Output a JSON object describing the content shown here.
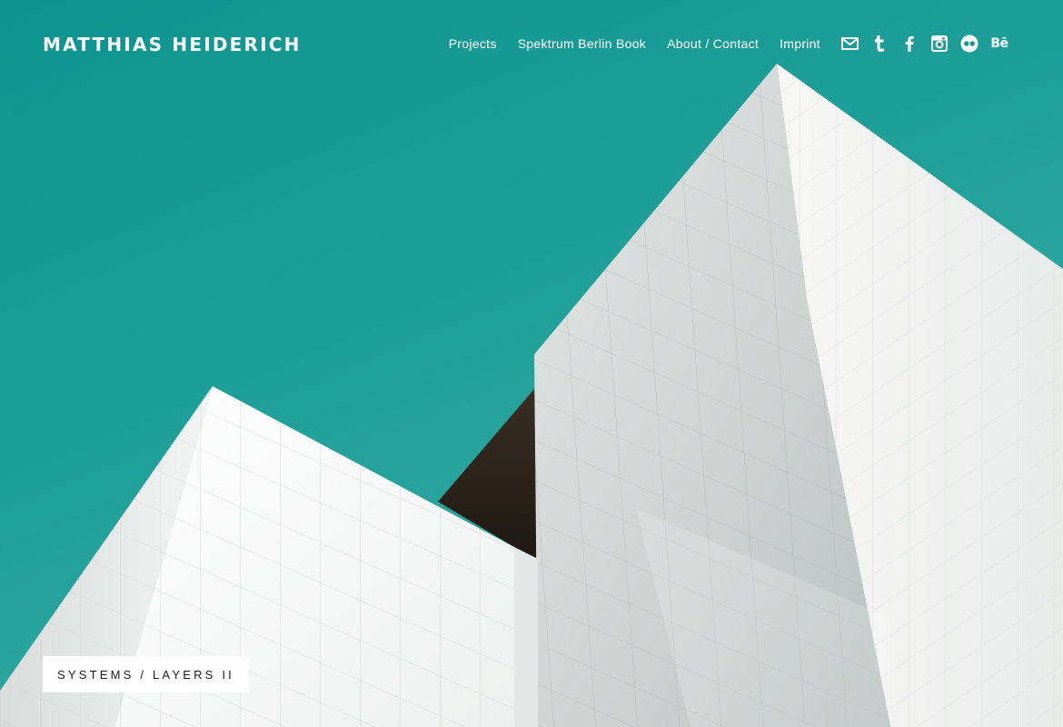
{
  "header": {
    "site_title": "MATTHIAS HEIDERICH"
  },
  "nav": {
    "items": [
      {
        "label": "Projects"
      },
      {
        "label": "Spektrum Berlin Book"
      },
      {
        "label": "About / Contact"
      },
      {
        "label": "Imprint"
      }
    ],
    "social": [
      {
        "icon": "mail-icon"
      },
      {
        "icon": "tumblr-icon"
      },
      {
        "icon": "facebook-icon"
      },
      {
        "icon": "instagram-icon"
      },
      {
        "icon": "flickr-icon"
      },
      {
        "icon": "behance-icon",
        "text": "Bē"
      }
    ]
  },
  "hero": {
    "caption": "SYSTEMS / LAYERS II"
  },
  "colors": {
    "sky": "#15968f",
    "building": "#f2f3f2",
    "shadow": "#2b231c",
    "text": "#ffffff"
  }
}
